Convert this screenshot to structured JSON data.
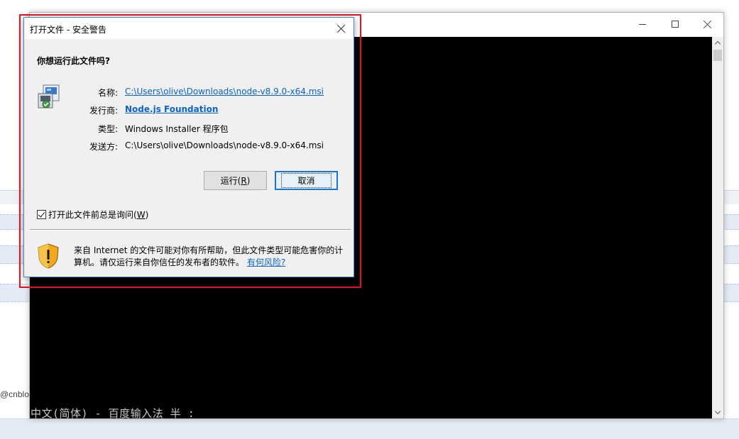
{
  "background": {
    "side_text": "@cnblog"
  },
  "console": {
    "minimize_glyph": "—",
    "maximize_glyph": "☐",
    "close_glyph": "✕",
    "ime_status": "中文(简体) - 百度输入法 半 :"
  },
  "dialog": {
    "title": "打开文件 - 安全警告",
    "question": "你想运行此文件吗?",
    "fields": [
      {
        "label": "名称:",
        "value": "C:\\Users\\olive\\Downloads\\node-v8.9.0-x64.msi",
        "style": "link"
      },
      {
        "label": "发行商:",
        "value": "Node.js Foundation",
        "style": "link-bold"
      },
      {
        "label": "类型:",
        "value": "Windows Installer 程序包",
        "style": "plain"
      },
      {
        "label": "发送方:",
        "value": "C:\\Users\\olive\\Downloads\\node-v8.9.0-x64.msi",
        "style": "plain"
      }
    ],
    "run_button": {
      "label": "运行(",
      "mnemonic": "R",
      "suffix": ")"
    },
    "cancel_button": {
      "label": "取消"
    },
    "checkbox": {
      "label": "打开此文件前总是询问(",
      "mnemonic": "W",
      "suffix": ")",
      "checked": true
    },
    "warning": {
      "text": "来自 Internet 的文件可能对你有所帮助，但此文件类型可能危害你的计算机。请仅运行来自你信任的发布者的软件。",
      "link": "有何风险?"
    }
  },
  "colors": {
    "highlight": "#e0141e",
    "link": "#0a63c7",
    "console_bg": "#000000"
  }
}
